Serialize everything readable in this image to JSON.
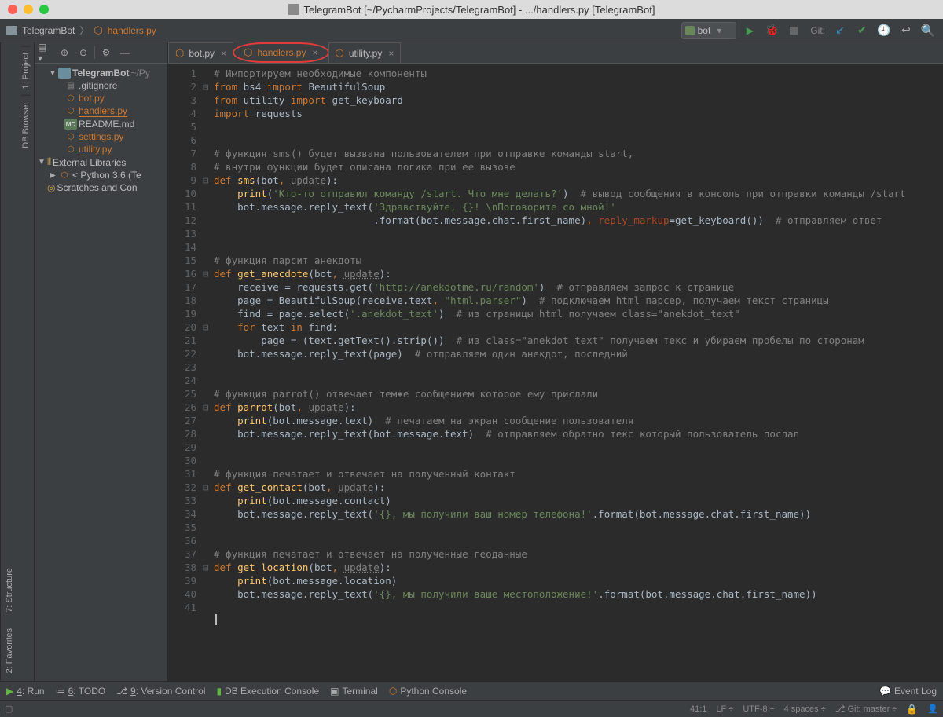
{
  "title": "TelegramBot [~/PycharmProjects/TelegramBot] - .../handlers.py [TelegramBot]",
  "breadcrumb": {
    "root": "TelegramBot",
    "file": "handlers.py"
  },
  "runConfig": {
    "selected": "bot"
  },
  "toolbar": {
    "git_label": "Git:"
  },
  "leftRail": [
    "1: Project",
    "DB Browser"
  ],
  "leftBottomRail": [
    "7: Structure",
    "2: Favorites"
  ],
  "tree": {
    "root": {
      "name": "TelegramBot",
      "path": "~/Py",
      "children": [
        ".gitignore",
        "bot.py",
        "handlers.py",
        "README.md",
        "settings.py",
        "utility.py"
      ]
    },
    "external": "External Libraries",
    "sdk": "< Python 3.6 (Te",
    "scratches": "Scratches and Con"
  },
  "tabs": [
    "bot.py",
    "handlers.py",
    "utility.py"
  ],
  "bottomTools": [
    "Run",
    "TODO",
    "Version Control",
    "DB Execution Console",
    "Terminal",
    "Python Console",
    "Event Log"
  ],
  "status": {
    "pos": "41:1",
    "sep": "LF",
    "enc": "UTF-8",
    "indent": "4 spaces",
    "branch": "Git: master"
  },
  "code": {
    "lines": [
      [
        [
          "c",
          "# Импортируем необходимые компоненты"
        ]
      ],
      [
        [
          "k",
          "from "
        ],
        [
          "p",
          "bs4 "
        ],
        [
          "k",
          "import "
        ],
        [
          "p",
          "BeautifulSoup"
        ]
      ],
      [
        [
          "k",
          "from "
        ],
        [
          "p",
          "utility "
        ],
        [
          "k",
          "import "
        ],
        [
          "p",
          "get_keyboard"
        ]
      ],
      [
        [
          "k",
          "import "
        ],
        [
          "p",
          "requests"
        ]
      ],
      [
        [
          "p",
          ""
        ]
      ],
      [
        [
          "p",
          ""
        ]
      ],
      [
        [
          "c",
          "# функция sms() будет вызвана пользователем при отправке команды start,"
        ]
      ],
      [
        [
          "c",
          "# внутри функции будет описана логика при ее вызове"
        ]
      ],
      [
        [
          "k",
          "def "
        ],
        [
          "fn",
          "sms"
        ],
        [
          "p",
          "(bot"
        ],
        [
          "k",
          ", "
        ],
        [
          "par",
          "update"
        ],
        [
          "p",
          "):"
        ]
      ],
      [
        [
          "p",
          "    "
        ],
        [
          "fn",
          "print"
        ],
        [
          "p",
          "("
        ],
        [
          "s",
          "'Кто-то отправил команду /start. Что мне делать?'"
        ],
        [
          "p",
          ")  "
        ],
        [
          "c",
          "# вывод сообщения в консоль при отправки команды /start"
        ]
      ],
      [
        [
          "p",
          "    bot.message.reply_text("
        ],
        [
          "s",
          "'Здравствуйте, {}! \\nПоговорите со мной!'"
        ]
      ],
      [
        [
          "p",
          "                           .format(bot.message.chat.first_name)"
        ],
        [
          "k",
          ", "
        ],
        [
          "na",
          "reply_markup"
        ],
        [
          "p",
          "=get_keyboard())  "
        ],
        [
          "c",
          "# отправляем ответ"
        ]
      ],
      [
        [
          "p",
          ""
        ]
      ],
      [
        [
          "p",
          ""
        ]
      ],
      [
        [
          "c",
          "# функция парсит анекдоты"
        ]
      ],
      [
        [
          "k",
          "def "
        ],
        [
          "fn",
          "get_anecdote"
        ],
        [
          "p",
          "(bot"
        ],
        [
          "k",
          ", "
        ],
        [
          "par",
          "update"
        ],
        [
          "p",
          "):"
        ]
      ],
      [
        [
          "p",
          "    receive = requests.get("
        ],
        [
          "s",
          "'http://anekdotme.ru/random'"
        ],
        [
          "p",
          ")  "
        ],
        [
          "c",
          "# отправляем запрос к странице"
        ]
      ],
      [
        [
          "p",
          "    page = BeautifulSoup(receive.text"
        ],
        [
          "k",
          ", "
        ],
        [
          "s",
          "\"html.parser\""
        ],
        [
          "p",
          ")  "
        ],
        [
          "c",
          "# подключаем html парсер, получаем текст страницы"
        ]
      ],
      [
        [
          "p",
          "    find = page.select("
        ],
        [
          "s",
          "'.anekdot_text'"
        ],
        [
          "p",
          ")  "
        ],
        [
          "c",
          "# из страницы html получаем class=\"anekdot_text\""
        ]
      ],
      [
        [
          "p",
          "    "
        ],
        [
          "k",
          "for "
        ],
        [
          "p",
          "text "
        ],
        [
          "k",
          "in "
        ],
        [
          "p",
          "find:"
        ]
      ],
      [
        [
          "p",
          "        page = (text.getText().strip())  "
        ],
        [
          "c",
          "# из class=\"anekdot_text\" получаем текс и убираем пробелы по сторонам"
        ]
      ],
      [
        [
          "p",
          "    bot.message.reply_text(page)  "
        ],
        [
          "c",
          "# отправляем один анекдот, последний"
        ]
      ],
      [
        [
          "p",
          ""
        ]
      ],
      [
        [
          "p",
          ""
        ]
      ],
      [
        [
          "c",
          "# функция parrot() отвечает темже сообщением которое ему прислали"
        ]
      ],
      [
        [
          "k",
          "def "
        ],
        [
          "fn",
          "parrot"
        ],
        [
          "p",
          "(bot"
        ],
        [
          "k",
          ", "
        ],
        [
          "par",
          "update"
        ],
        [
          "p",
          "):"
        ]
      ],
      [
        [
          "p",
          "    "
        ],
        [
          "fn",
          "print"
        ],
        [
          "p",
          "(bot.message.text)  "
        ],
        [
          "c",
          "# печатаем на экран сообщение пользователя"
        ]
      ],
      [
        [
          "p",
          "    bot.message.reply_text(bot.message.text)  "
        ],
        [
          "c",
          "# отправляем обратно текс который пользователь послал"
        ]
      ],
      [
        [
          "p",
          ""
        ]
      ],
      [
        [
          "p",
          ""
        ]
      ],
      [
        [
          "c",
          "# функция печатает и отвечает на полученный контакт"
        ]
      ],
      [
        [
          "k",
          "def "
        ],
        [
          "fn",
          "get_contact"
        ],
        [
          "p",
          "(bot"
        ],
        [
          "k",
          ", "
        ],
        [
          "par",
          "update"
        ],
        [
          "p",
          "):"
        ]
      ],
      [
        [
          "p",
          "    "
        ],
        [
          "fn",
          "print"
        ],
        [
          "p",
          "(bot.message.contact)"
        ]
      ],
      [
        [
          "p",
          "    bot.message.reply_text("
        ],
        [
          "s",
          "'{}, мы получили ваш номер телефона!'"
        ],
        [
          "p",
          ".format(bot.message.chat.first_name))"
        ]
      ],
      [
        [
          "p",
          ""
        ]
      ],
      [
        [
          "p",
          ""
        ]
      ],
      [
        [
          "c",
          "# функция печатает и отвечает на полученные геоданные"
        ]
      ],
      [
        [
          "k",
          "def "
        ],
        [
          "fn",
          "get_location"
        ],
        [
          "p",
          "(bot"
        ],
        [
          "k",
          ", "
        ],
        [
          "par",
          "update"
        ],
        [
          "p",
          "):"
        ]
      ],
      [
        [
          "p",
          "    "
        ],
        [
          "fn",
          "print"
        ],
        [
          "p",
          "(bot.message.location)"
        ]
      ],
      [
        [
          "p",
          "    bot.message.reply_text("
        ],
        [
          "s",
          "'{}, мы получили ваше местоположение!'"
        ],
        [
          "p",
          ".format(bot.message.chat.first_name))"
        ]
      ],
      [
        [
          "p",
          ""
        ]
      ]
    ],
    "folds": {
      "2": "⊟",
      "9": "⊟",
      "16": "⊟",
      "20": "⊟",
      "26": "⊟",
      "32": "⊟",
      "38": "⊟"
    }
  }
}
